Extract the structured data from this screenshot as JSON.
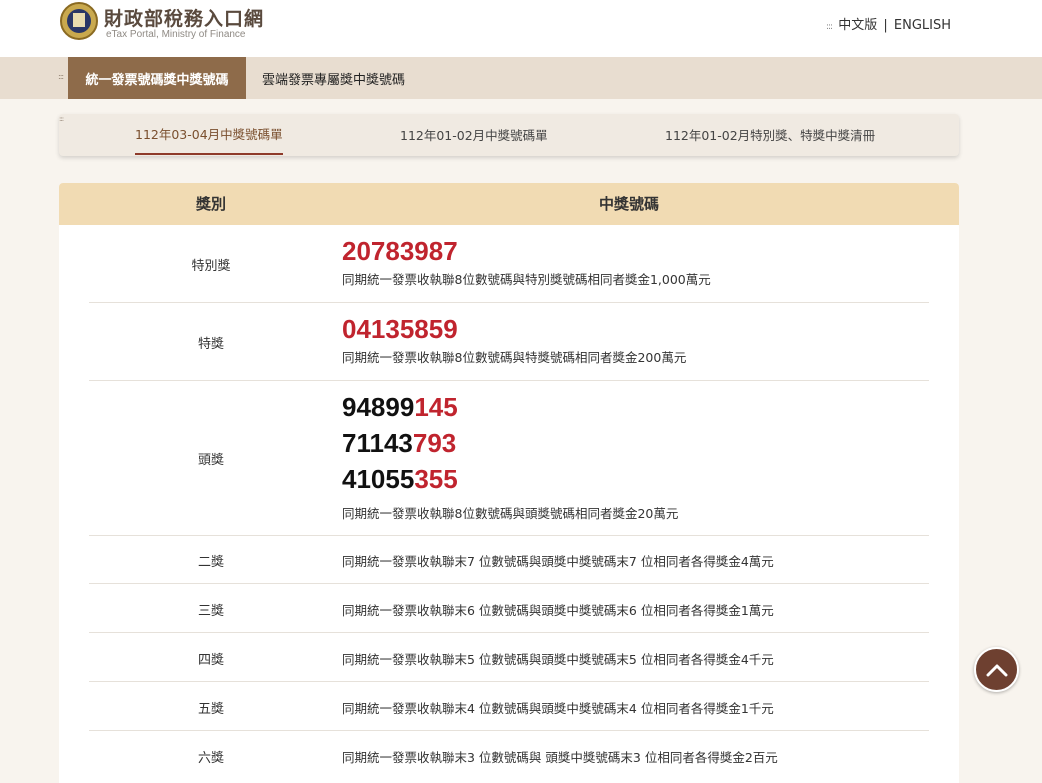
{
  "header": {
    "title": "財政部稅務入口網",
    "subtitle": "eTax Portal, Ministry of Finance",
    "lang_zh": "中文版",
    "lang_separator": "|",
    "lang_en": "ENGLISH"
  },
  "main_nav": {
    "items": [
      {
        "label": "統一發票號碼獎中獎號碼",
        "active": true
      },
      {
        "label": "雲端發票專屬獎中獎號碼",
        "active": false
      }
    ]
  },
  "sub_nav": {
    "tabs": [
      {
        "label": "112年03-04月中獎號碼單",
        "active": true
      },
      {
        "label": "112年01-02月中獎號碼單",
        "active": false
      },
      {
        "label": "112年01-02月特別獎、特獎中獎清冊",
        "active": false
      }
    ]
  },
  "table": {
    "headers": {
      "category": "獎別",
      "numbers": "中獎號碼"
    },
    "rows": [
      {
        "category": "特別獎",
        "number_black": "",
        "number_red": "20783987",
        "desc": "同期統一發票收執聯8位數號碼與特別獎號碼相同者獎金1,000萬元"
      },
      {
        "category": "特獎",
        "number_black": "",
        "number_red": "04135859",
        "desc": "同期統一發票收執聯8位數號碼與特獎號碼相同者獎金200萬元"
      },
      {
        "category": "頭獎",
        "numbers": [
          {
            "black": "94899",
            "red": "145"
          },
          {
            "black": "71143",
            "red": "793"
          },
          {
            "black": "41055",
            "red": "355"
          }
        ],
        "desc": "同期統一發票收執聯8位數號碼與頭獎號碼相同者獎金20萬元"
      },
      {
        "category": "二獎",
        "desc": "同期統一發票收執聯末7 位數號碼與頭獎中獎號碼末7 位相同者各得獎金4萬元"
      },
      {
        "category": "三獎",
        "desc": "同期統一發票收執聯末6 位數號碼與頭獎中獎號碼末6 位相同者各得獎金1萬元"
      },
      {
        "category": "四獎",
        "desc": "同期統一發票收執聯末5 位數號碼與頭獎中獎號碼末5 位相同者各得獎金4千元"
      },
      {
        "category": "五獎",
        "desc": "同期統一發票收執聯末4 位數號碼與頭獎中獎號碼末4 位相同者各得獎金1千元"
      },
      {
        "category": "六獎",
        "desc": "同期統一發票收執聯末3 位數號碼與 頭獎中獎號碼末3 位相同者各得獎金2百元"
      }
    ]
  },
  "colors": {
    "accent_brown": "#8e6b4a",
    "winning_red": "#c0242e",
    "header_tan": "#f1dbb3"
  },
  "icons": {
    "back_to_top": "chevron-up-icon",
    "logo": "ministry-emblem-icon"
  }
}
